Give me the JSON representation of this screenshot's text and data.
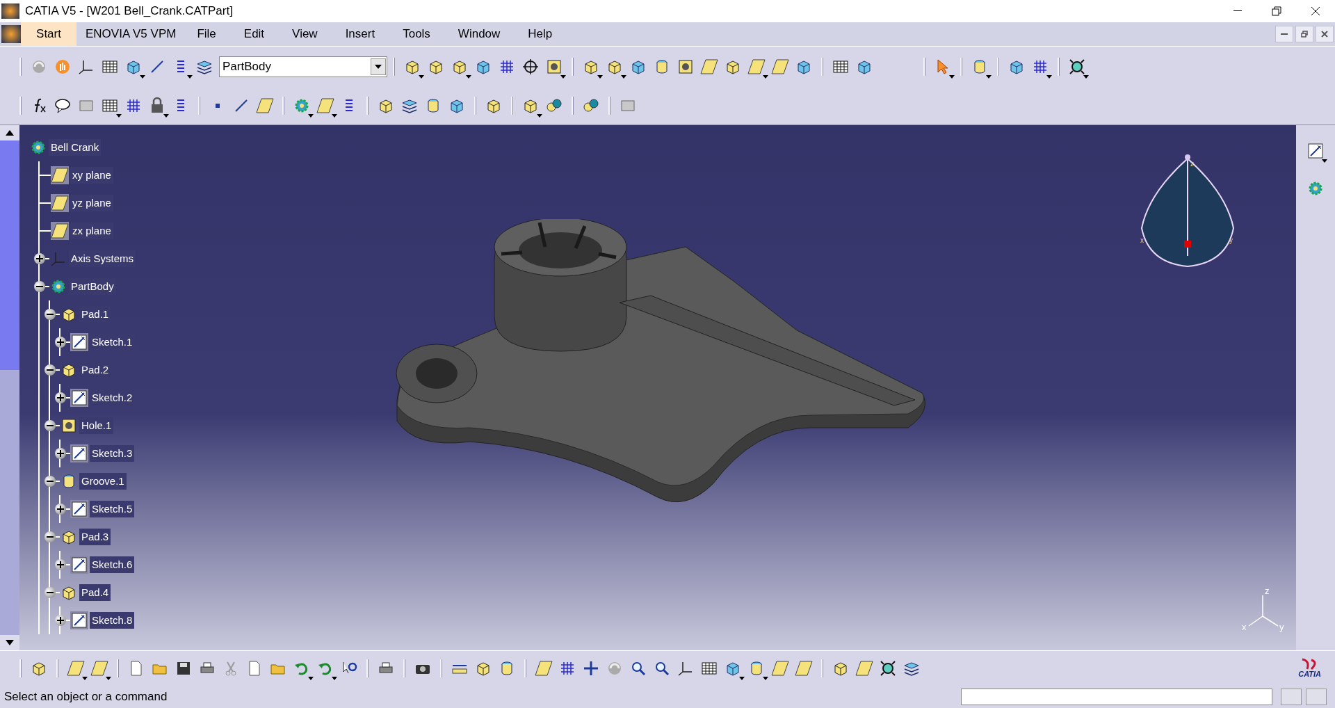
{
  "window": {
    "title": "CATIA V5 - [W201 Bell_Crank.CATPart]"
  },
  "menu": [
    {
      "label": "Start",
      "selected": true
    },
    {
      "label": "ENOVIA V5 VPM",
      "selected": false
    },
    {
      "label": "File",
      "selected": false
    },
    {
      "label": "Edit",
      "selected": false
    },
    {
      "label": "View",
      "selected": false
    },
    {
      "label": "Insert",
      "selected": false
    },
    {
      "label": "Tools",
      "selected": false
    },
    {
      "label": "Window",
      "selected": false
    },
    {
      "label": "Help",
      "selected": false
    }
  ],
  "toolbar": {
    "body_select": {
      "value": "PartBody"
    }
  },
  "tree": {
    "label": "Bell Crank",
    "kind": "part",
    "children": [
      {
        "label": "xy plane",
        "kind": "plane"
      },
      {
        "label": "yz plane",
        "kind": "plane"
      },
      {
        "label": "zx plane",
        "kind": "plane"
      },
      {
        "label": "Axis Systems",
        "kind": "axis",
        "expanded": false
      },
      {
        "label": "PartBody",
        "kind": "body",
        "expanded": true,
        "children": [
          {
            "label": "Pad.1",
            "kind": "pad",
            "expanded": true,
            "children": [
              {
                "label": "Sketch.1",
                "kind": "sketch",
                "expanded": false
              }
            ]
          },
          {
            "label": "Pad.2",
            "kind": "pad",
            "expanded": true,
            "children": [
              {
                "label": "Sketch.2",
                "kind": "sketch",
                "expanded": false
              }
            ]
          },
          {
            "label": "Hole.1",
            "kind": "hole",
            "expanded": true,
            "children": [
              {
                "label": "Sketch.3",
                "kind": "sketch",
                "expanded": false
              }
            ]
          },
          {
            "label": "Groove.1",
            "kind": "groove",
            "expanded": true,
            "children": [
              {
                "label": "Sketch.5",
                "kind": "sketch",
                "expanded": false
              }
            ]
          },
          {
            "label": "Pad.3",
            "kind": "pad",
            "expanded": true,
            "children": [
              {
                "label": "Sketch.6",
                "kind": "sketch",
                "expanded": false
              }
            ]
          },
          {
            "label": "Pad.4",
            "kind": "pad",
            "expanded": true,
            "children": [
              {
                "label": "Sketch.8",
                "kind": "sketch",
                "expanded": false
              }
            ]
          }
        ]
      }
    ]
  },
  "compass": {
    "labels": [
      "z",
      "x",
      "y"
    ]
  },
  "axis_triad": {
    "labels": [
      "z",
      "x",
      "y"
    ]
  },
  "logo": {
    "text": "CATIA"
  },
  "status_bar": {
    "message": "Select an object or a command"
  }
}
